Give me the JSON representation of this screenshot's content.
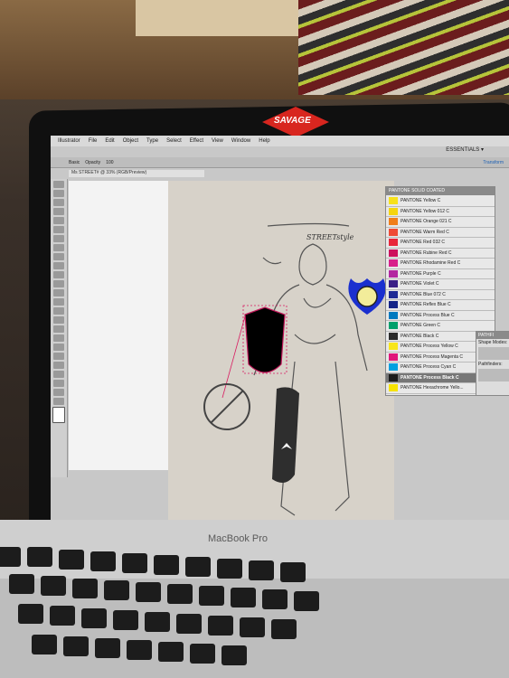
{
  "sticker": {
    "text": "SAVAGE"
  },
  "menubar": {
    "items": [
      "Illustrator",
      "File",
      "Edit",
      "Object",
      "Type",
      "Select",
      "Effect",
      "View",
      "Window",
      "Help"
    ]
  },
  "workspace": {
    "label": "ESSENTIALS ▾"
  },
  "controlbar": {
    "opacity_label": "Opacity",
    "opacity_value": "100",
    "stroke_label": "Basic",
    "transform_label": "Transform"
  },
  "document": {
    "tab": "Ms STREET# @ 33% (RGB/Preview)"
  },
  "sketch": {
    "label": "STREETstyle"
  },
  "swatch_panel": {
    "title": "PANTONE SOLID COATED",
    "rows": [
      {
        "name": "PANTONE Yellow C",
        "color": "#f7e11b"
      },
      {
        "name": "PANTONE Yellow 012 C",
        "color": "#f5d50f"
      },
      {
        "name": "PANTONE Orange 021 C",
        "color": "#f07e1a"
      },
      {
        "name": "PANTONE Warm Red C",
        "color": "#ef4a35"
      },
      {
        "name": "PANTONE Red 032 C",
        "color": "#e8263a"
      },
      {
        "name": "PANTONE Rubine Red C",
        "color": "#cd0f5c"
      },
      {
        "name": "PANTONE Rhodamine Red C",
        "color": "#d8208a"
      },
      {
        "name": "PANTONE Purple C",
        "color": "#b327a0"
      },
      {
        "name": "PANTONE Violet C",
        "color": "#3a1f87"
      },
      {
        "name": "PANTONE Blue 072 C",
        "color": "#1f2a95"
      },
      {
        "name": "PANTONE Reflex Blue C",
        "color": "#142487"
      },
      {
        "name": "PANTONE Process Blue C",
        "color": "#0079bf"
      },
      {
        "name": "PANTONE Green C",
        "color": "#00a06b"
      },
      {
        "name": "PANTONE Black C",
        "color": "#2b2b2b"
      },
      {
        "name": "PANTONE Process Yellow C",
        "color": "#f8e61a"
      },
      {
        "name": "PANTONE Process Magenta C",
        "color": "#e0167a"
      },
      {
        "name": "PANTONE Process Cyan C",
        "color": "#00a0e0"
      },
      {
        "name": "PANTONE Process Black C",
        "color": "#1b1b1b"
      },
      {
        "name": "PANTONE Hexachrome Yello...",
        "color": "#f6e200"
      }
    ]
  },
  "pathfinder": {
    "title": "PATHFI",
    "shape_modes": "Shape Modes:",
    "pathfinders": "Pathfinders:"
  },
  "laptop": {
    "brand": "MacBook Pro"
  }
}
